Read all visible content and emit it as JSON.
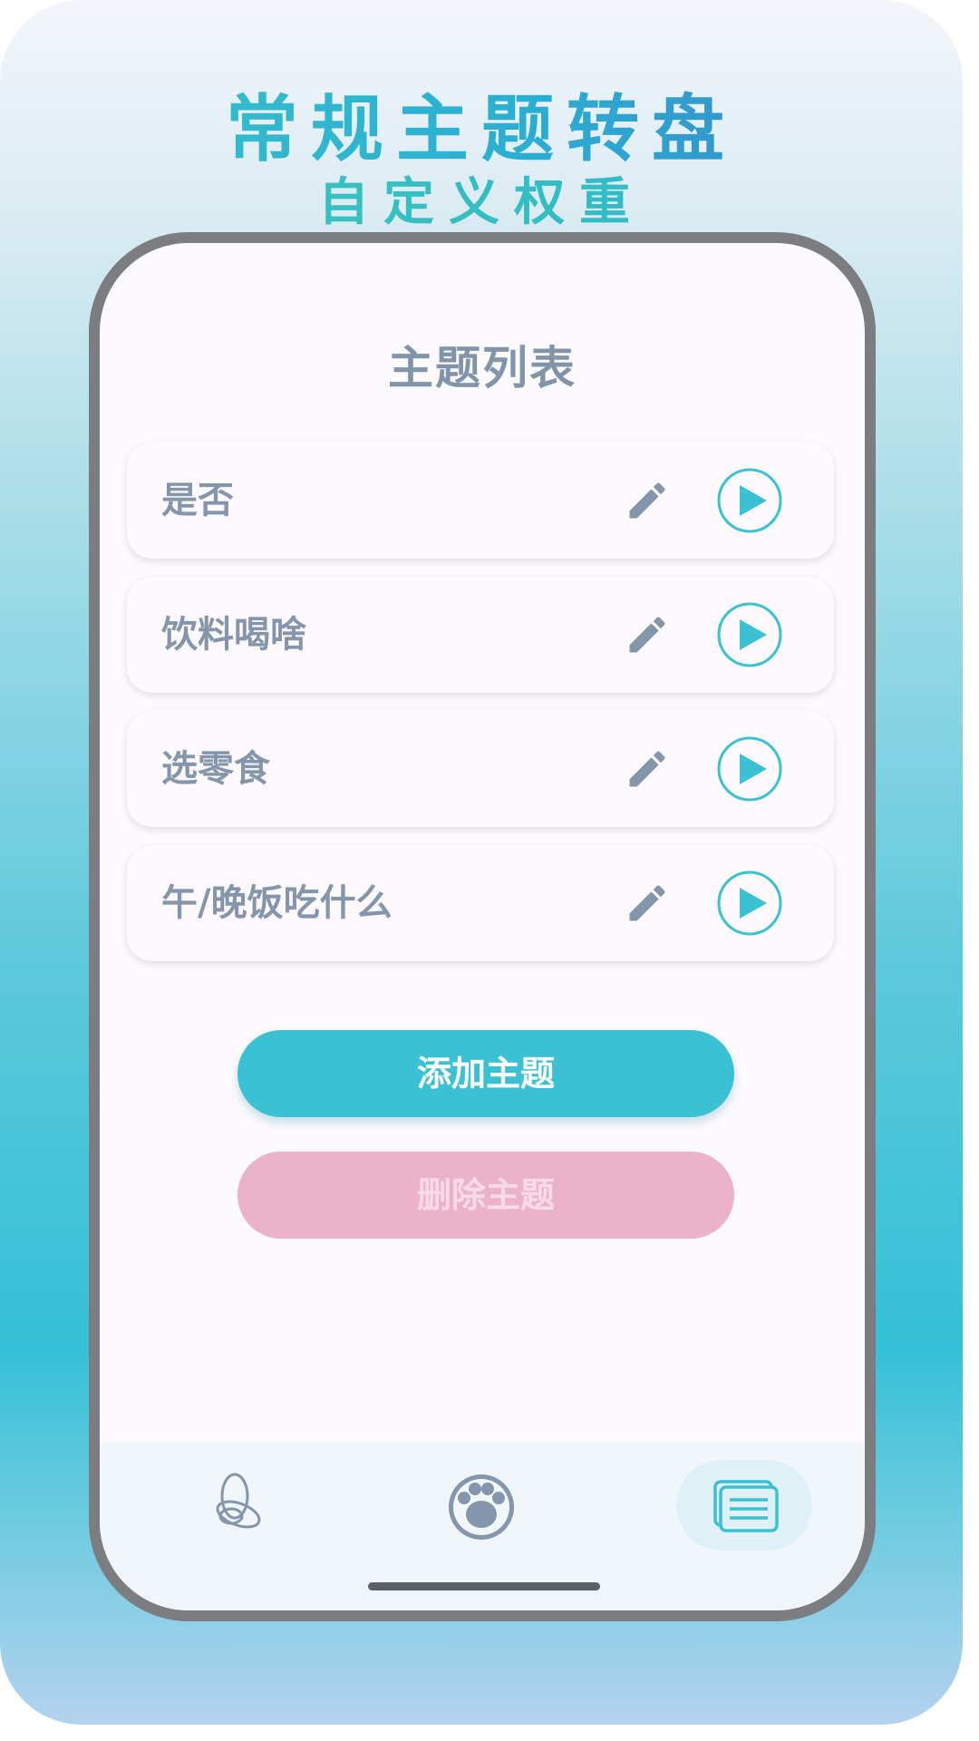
{
  "poster": {
    "headline": "常规主题转盘",
    "subheadline": "自定义权重"
  },
  "screen": {
    "title": "主题列表",
    "topics": [
      {
        "name": "是否"
      },
      {
        "name": "饮料喝啥"
      },
      {
        "name": "选零食"
      },
      {
        "name": "午/晚饭吃什么"
      }
    ],
    "add_button": "添加主题",
    "delete_button": "删除主题"
  },
  "tab_bar": {
    "tabs": [
      {
        "icon": "wheel-knot-icon",
        "active": false
      },
      {
        "icon": "paw-icon",
        "active": false
      },
      {
        "icon": "list-cards-icon",
        "active": true
      }
    ]
  },
  "colors": {
    "accent": "#3ac1d3",
    "delete": "#ecb2c8",
    "text": "#8496ab",
    "frame": "#7b7d80"
  }
}
